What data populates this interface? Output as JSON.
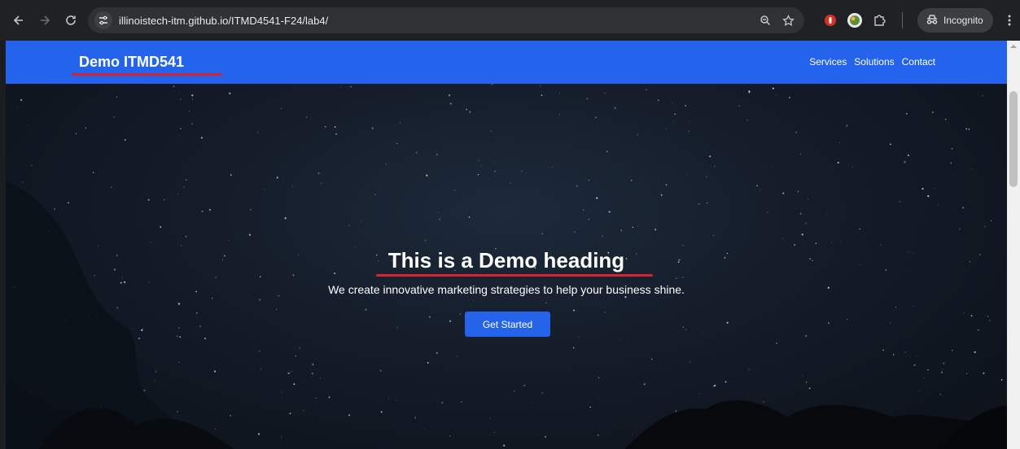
{
  "browser": {
    "url": "illinoistech-itm.github.io/ITMD4541-F24/lab4/",
    "incognito_label": "Incognito",
    "icons": [
      "back-icon",
      "forward-icon",
      "reload-icon",
      "site-info-icon",
      "zoom-icon",
      "bookmark-star-icon",
      "extension-red-icon",
      "extension-green-icon",
      "extensions-puzzle-icon",
      "incognito-icon",
      "more-menu-icon"
    ]
  },
  "site": {
    "brand": "Demo ITMD541",
    "nav": [
      "Services",
      "Solutions",
      "Contact"
    ],
    "hero": {
      "title": "This is a Demo heading",
      "subtitle": "We create innovative marketing strategies to help your business shine.",
      "cta": "Get Started"
    }
  },
  "colors": {
    "header_bg": "#2463eb",
    "button_bg": "#2563eb",
    "annotation_underline": "#d9232d",
    "hero_bg": "#151d2a"
  }
}
